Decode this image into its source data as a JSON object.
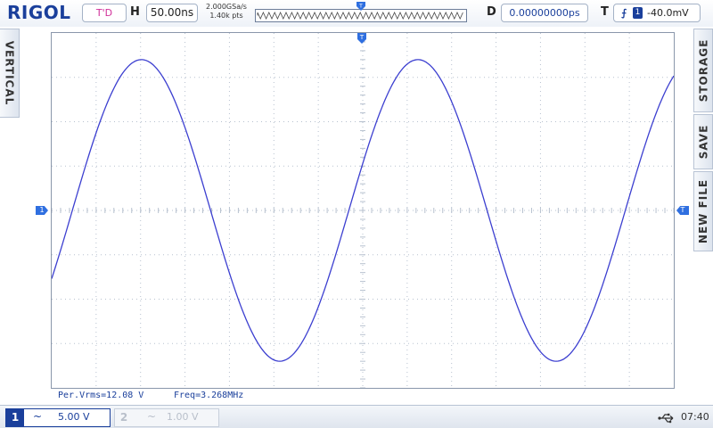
{
  "header": {
    "brand": "RIGOL",
    "run_status": "T'D",
    "horizontal_label": "H",
    "timebase": "50.00ns",
    "sample_rate": "2.000GSa/s",
    "memory_depth": "1.40k pts",
    "delay_label": "D",
    "delay": "0.00000000ps",
    "trigger_label": "T",
    "trigger_source": "1",
    "trigger_level": "-40.0mV"
  },
  "side_menu": {
    "left_tab": "VERTICAL",
    "right_tabs": [
      "STORAGE",
      "SAVE",
      "NEW FILE"
    ]
  },
  "markers": {
    "channel1": "1",
    "trigger_level": "T",
    "trigger_position": "T"
  },
  "waveform": {
    "channel": "1",
    "color": "#3c3fd0",
    "shape": "sine",
    "frequency": "3.268MHz",
    "vrms": "12.08 V",
    "cycles_on_screen": 2.25
  },
  "measurements": {
    "vrms": "Per.Vrms=12.08 V",
    "freq": "Freq=3.268MHz"
  },
  "footer": {
    "ch1_number": "1",
    "ch1_coupling": "~",
    "ch1_scale": "5.00 V",
    "ch2_number": "2",
    "ch2_coupling": "~",
    "ch2_scale": "1.00 V",
    "time": "07:40"
  },
  "colors": {
    "trace": "#3c3fd0",
    "grid": "#b7c1cf",
    "brand": "#1a3f9b",
    "run_status": "#d1309a"
  }
}
